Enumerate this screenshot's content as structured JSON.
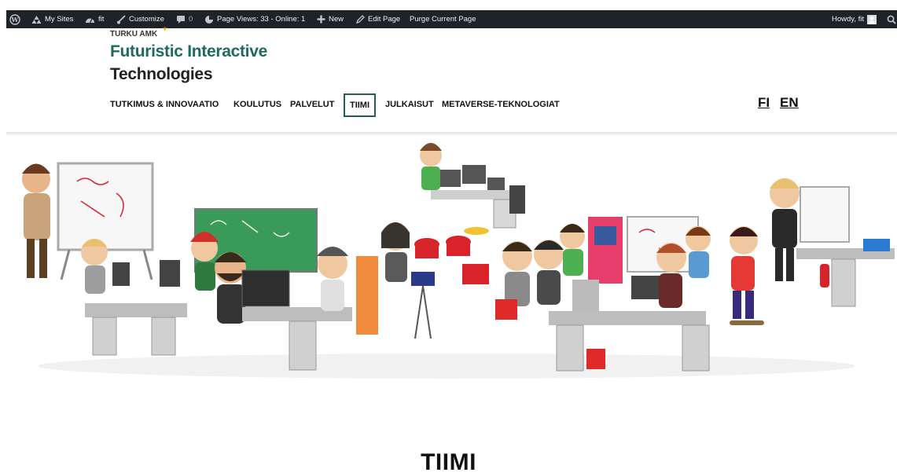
{
  "admin_bar": {
    "my_sites": "My Sites",
    "site_name": "fit",
    "customize": "Customize",
    "comments_count": "0",
    "page_views": "Page Views: 33 - Online: 1",
    "new": "New",
    "edit_page": "Edit Page",
    "purge": "Purge Current Page",
    "howdy": "Howdy, fit"
  },
  "logo": {
    "org": "TURKU AMK",
    "line1": "Futuristic Interactive",
    "line2": "Technologies"
  },
  "nav": {
    "items": [
      "TUTKIMUS & INNOVAATIO",
      "KOULUTUS",
      "PALVELUT",
      "TIIMI",
      "JULKAISUT",
      "METAVERSE-TEKNOLOGIAT"
    ],
    "active": "TIIMI"
  },
  "languages": [
    "FI",
    "EN"
  ],
  "page_title": "TIIMI",
  "colors": {
    "admin_bar_bg": "#1d2327",
    "brand_green": "#1d6b5e",
    "active_border": "#245c54"
  }
}
